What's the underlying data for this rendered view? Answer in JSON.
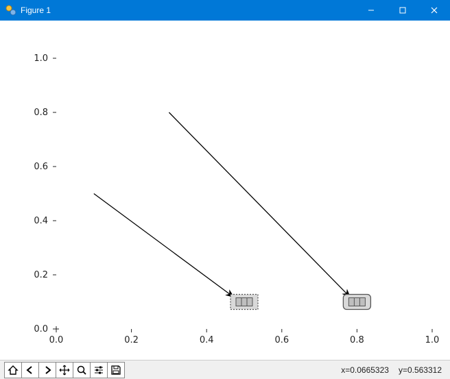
{
  "window": {
    "title": "Figure 1"
  },
  "toolbar": {
    "home": "home-icon",
    "back": "back-icon",
    "forward": "forward-icon",
    "pan": "pan-icon",
    "zoom": "zoom-icon",
    "subplots": "subplots-icon",
    "save": "save-icon"
  },
  "status": {
    "x_label": "x=0.0665323",
    "y_label": "y=0.563312"
  },
  "chart_data": {
    "type": "scatter",
    "title": "",
    "xlabel": "",
    "ylabel": "",
    "xlim": [
      0.0,
      1.0
    ],
    "ylim": [
      0.0,
      1.0
    ],
    "x_ticks": [
      0.0,
      0.2,
      0.4,
      0.6,
      0.8,
      1.0
    ],
    "y_ticks": [
      0.0,
      0.2,
      0.4,
      0.6,
      0.8,
      1.0
    ],
    "x_tick_labels": [
      "0.0",
      "0.2",
      "0.4",
      "0.6",
      "0.8",
      "1.0"
    ],
    "y_tick_labels": [
      "0.0",
      "0.2",
      "0.4",
      "0.6",
      "0.8",
      "1.0"
    ],
    "arrows": [
      {
        "start": [
          0.1,
          0.5
        ],
        "end": [
          0.47,
          0.12
        ]
      },
      {
        "start": [
          0.3,
          0.8
        ],
        "end": [
          0.78,
          0.12
        ]
      }
    ],
    "legend_boxes": [
      {
        "pos": [
          0.5,
          0.1
        ],
        "style": "dashed"
      },
      {
        "pos": [
          0.8,
          0.1
        ],
        "style": "rounded"
      }
    ]
  }
}
